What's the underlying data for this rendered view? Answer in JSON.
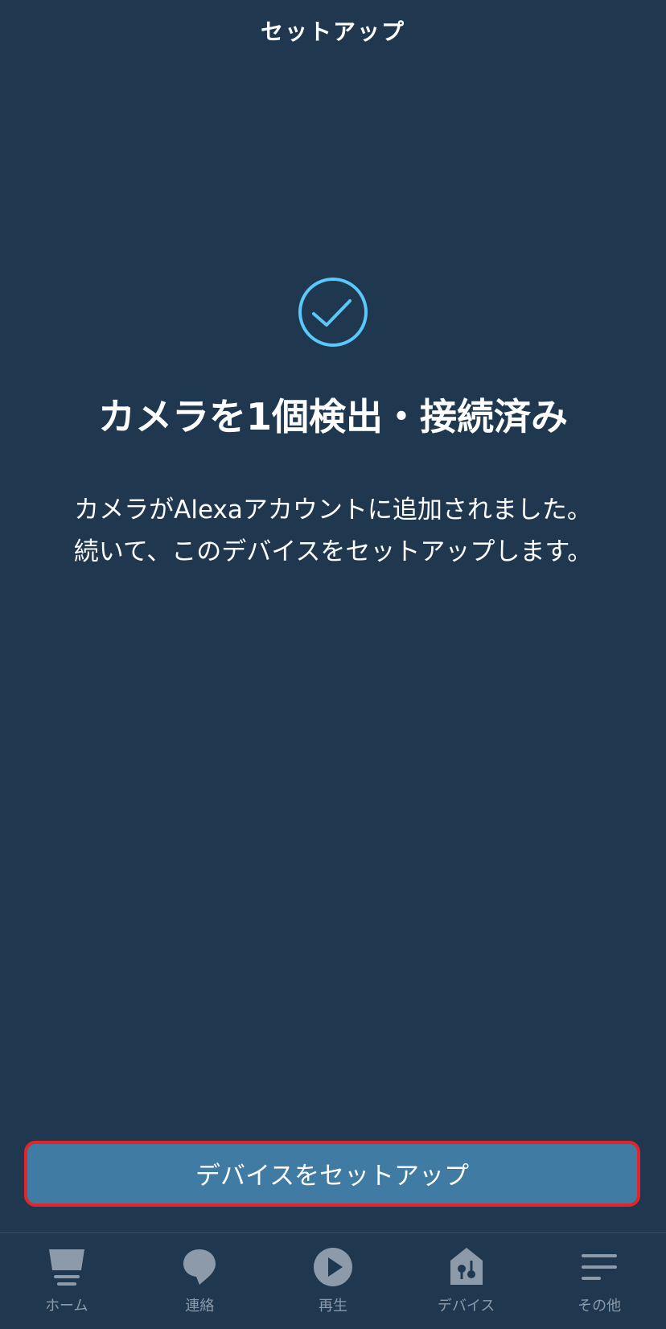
{
  "header": {
    "title": "セットアップ"
  },
  "status": {
    "icon": "check-circle-icon",
    "title": "カメラを1個検出・接続済み",
    "description_lines": [
      "カメラがAlexaアカウントに追加されました。",
      "続いて、このデバイスをセットアップします。"
    ]
  },
  "primary_button": {
    "label": "デバイスをセットアップ"
  },
  "tabbar": {
    "items": [
      {
        "label": "ホーム",
        "icon": "home-icon"
      },
      {
        "label": "連絡",
        "icon": "chat-bubble-icon"
      },
      {
        "label": "再生",
        "icon": "play-icon"
      },
      {
        "label": "デバイス",
        "icon": "devices-icon"
      },
      {
        "label": "その他",
        "icon": "menu-icon"
      }
    ]
  },
  "colors": {
    "background": "#1f384f",
    "accent": "#5ac8fa",
    "button": "#407ba3",
    "highlight_border": "#e3242b",
    "tab_inactive": "#8c9aaa"
  }
}
